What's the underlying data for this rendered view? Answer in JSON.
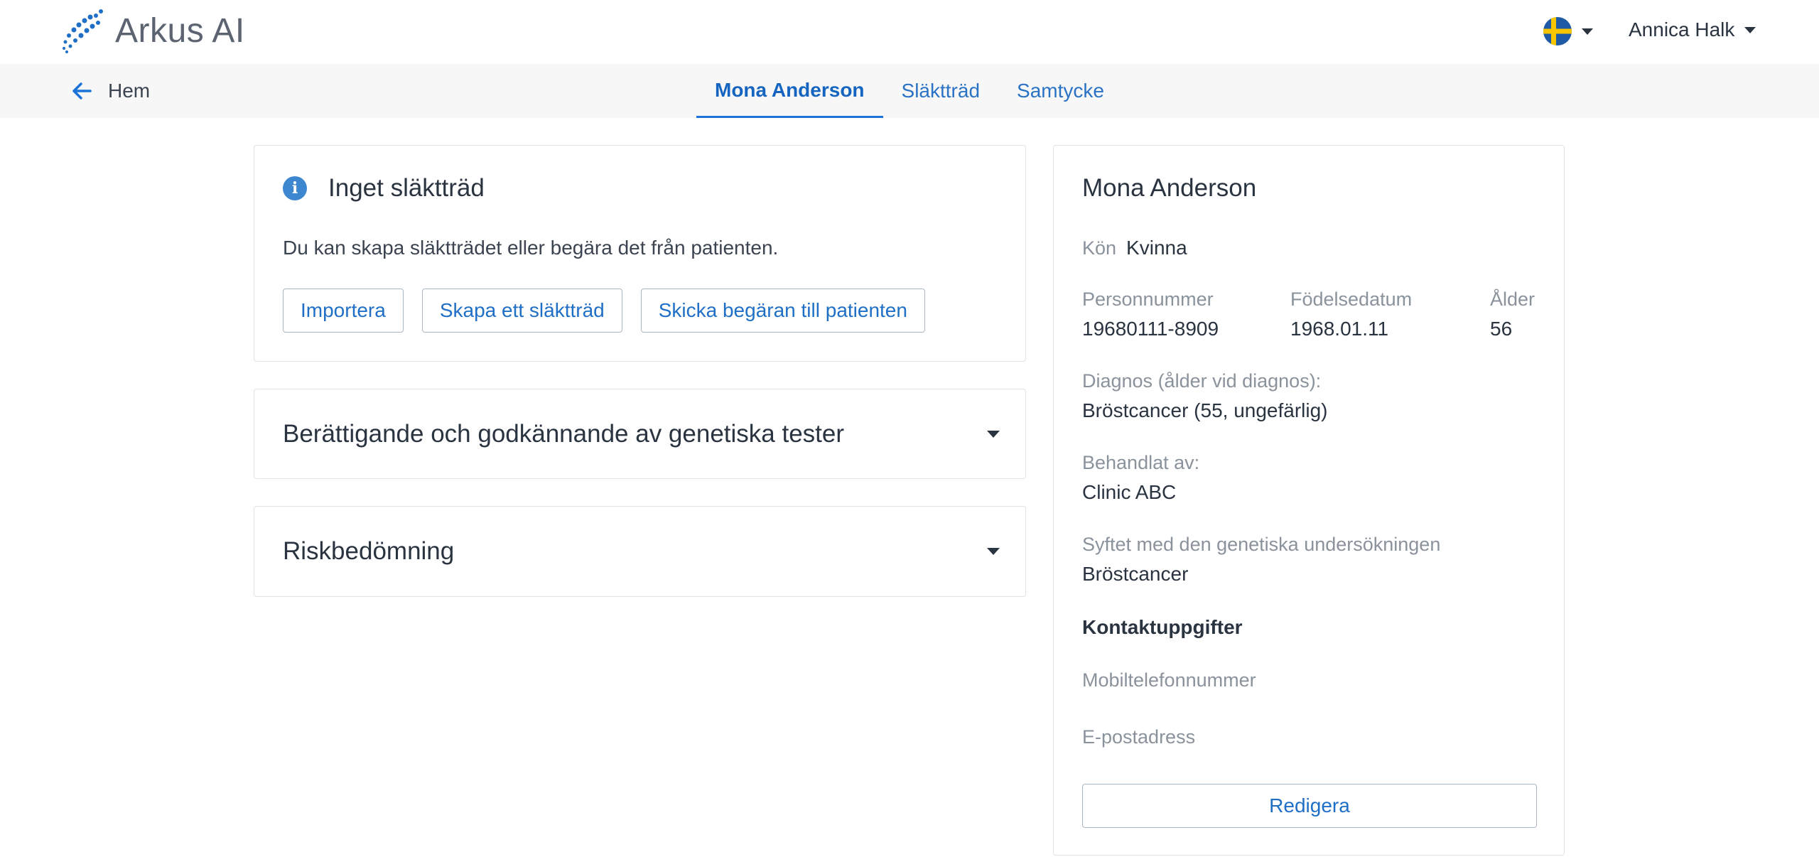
{
  "header": {
    "app_name": "Arkus AI",
    "language_flag": "sweden-flag",
    "user_name": "Annica Halk"
  },
  "nav": {
    "back_label": "Hem",
    "tabs": [
      {
        "label": "Mona Anderson",
        "active": true
      },
      {
        "label": "Släktträd",
        "active": false
      },
      {
        "label": "Samtycke",
        "active": false
      }
    ]
  },
  "family_tree_card": {
    "title": "Inget släktträd",
    "description": "Du kan skapa släktträdet eller begära det från patienten.",
    "buttons": {
      "import": "Importera",
      "create": "Skapa ett släktträd",
      "request": "Skicka begäran till patienten"
    }
  },
  "sections": {
    "eligibility": "Berättigande och godkännande av genetiska tester",
    "risk": "Riskbedömning"
  },
  "patient": {
    "name": "Mona Anderson",
    "gender_label": "Kön",
    "gender_value": "Kvinna",
    "pnr_label": "Personnummer",
    "pnr_value": "19680111-8909",
    "dob_label": "Födelsedatum",
    "dob_value": "1968.01.11",
    "age_label": "Ålder",
    "age_value": "56",
    "diagnosis_label": "Diagnos (ålder vid diagnos):",
    "diagnosis_value": "Bröstcancer (55, ungefärlig)",
    "treated_by_label": "Behandlat av:",
    "treated_by_value": "Clinic ABC",
    "purpose_label": "Syftet med den genetiska undersökningen",
    "purpose_value": "Bröstcancer",
    "contact_heading": "Kontaktuppgifter",
    "mobile_label": "Mobiltelefonnummer",
    "email_label": "E-postadress",
    "edit_button": "Redigera"
  },
  "colors": {
    "accent": "#1a73d9",
    "nav_bg": "#f7f7f7",
    "border": "#dde3e8",
    "flag_blue": "#1f5aa6",
    "flag_yellow": "#f7c600"
  }
}
